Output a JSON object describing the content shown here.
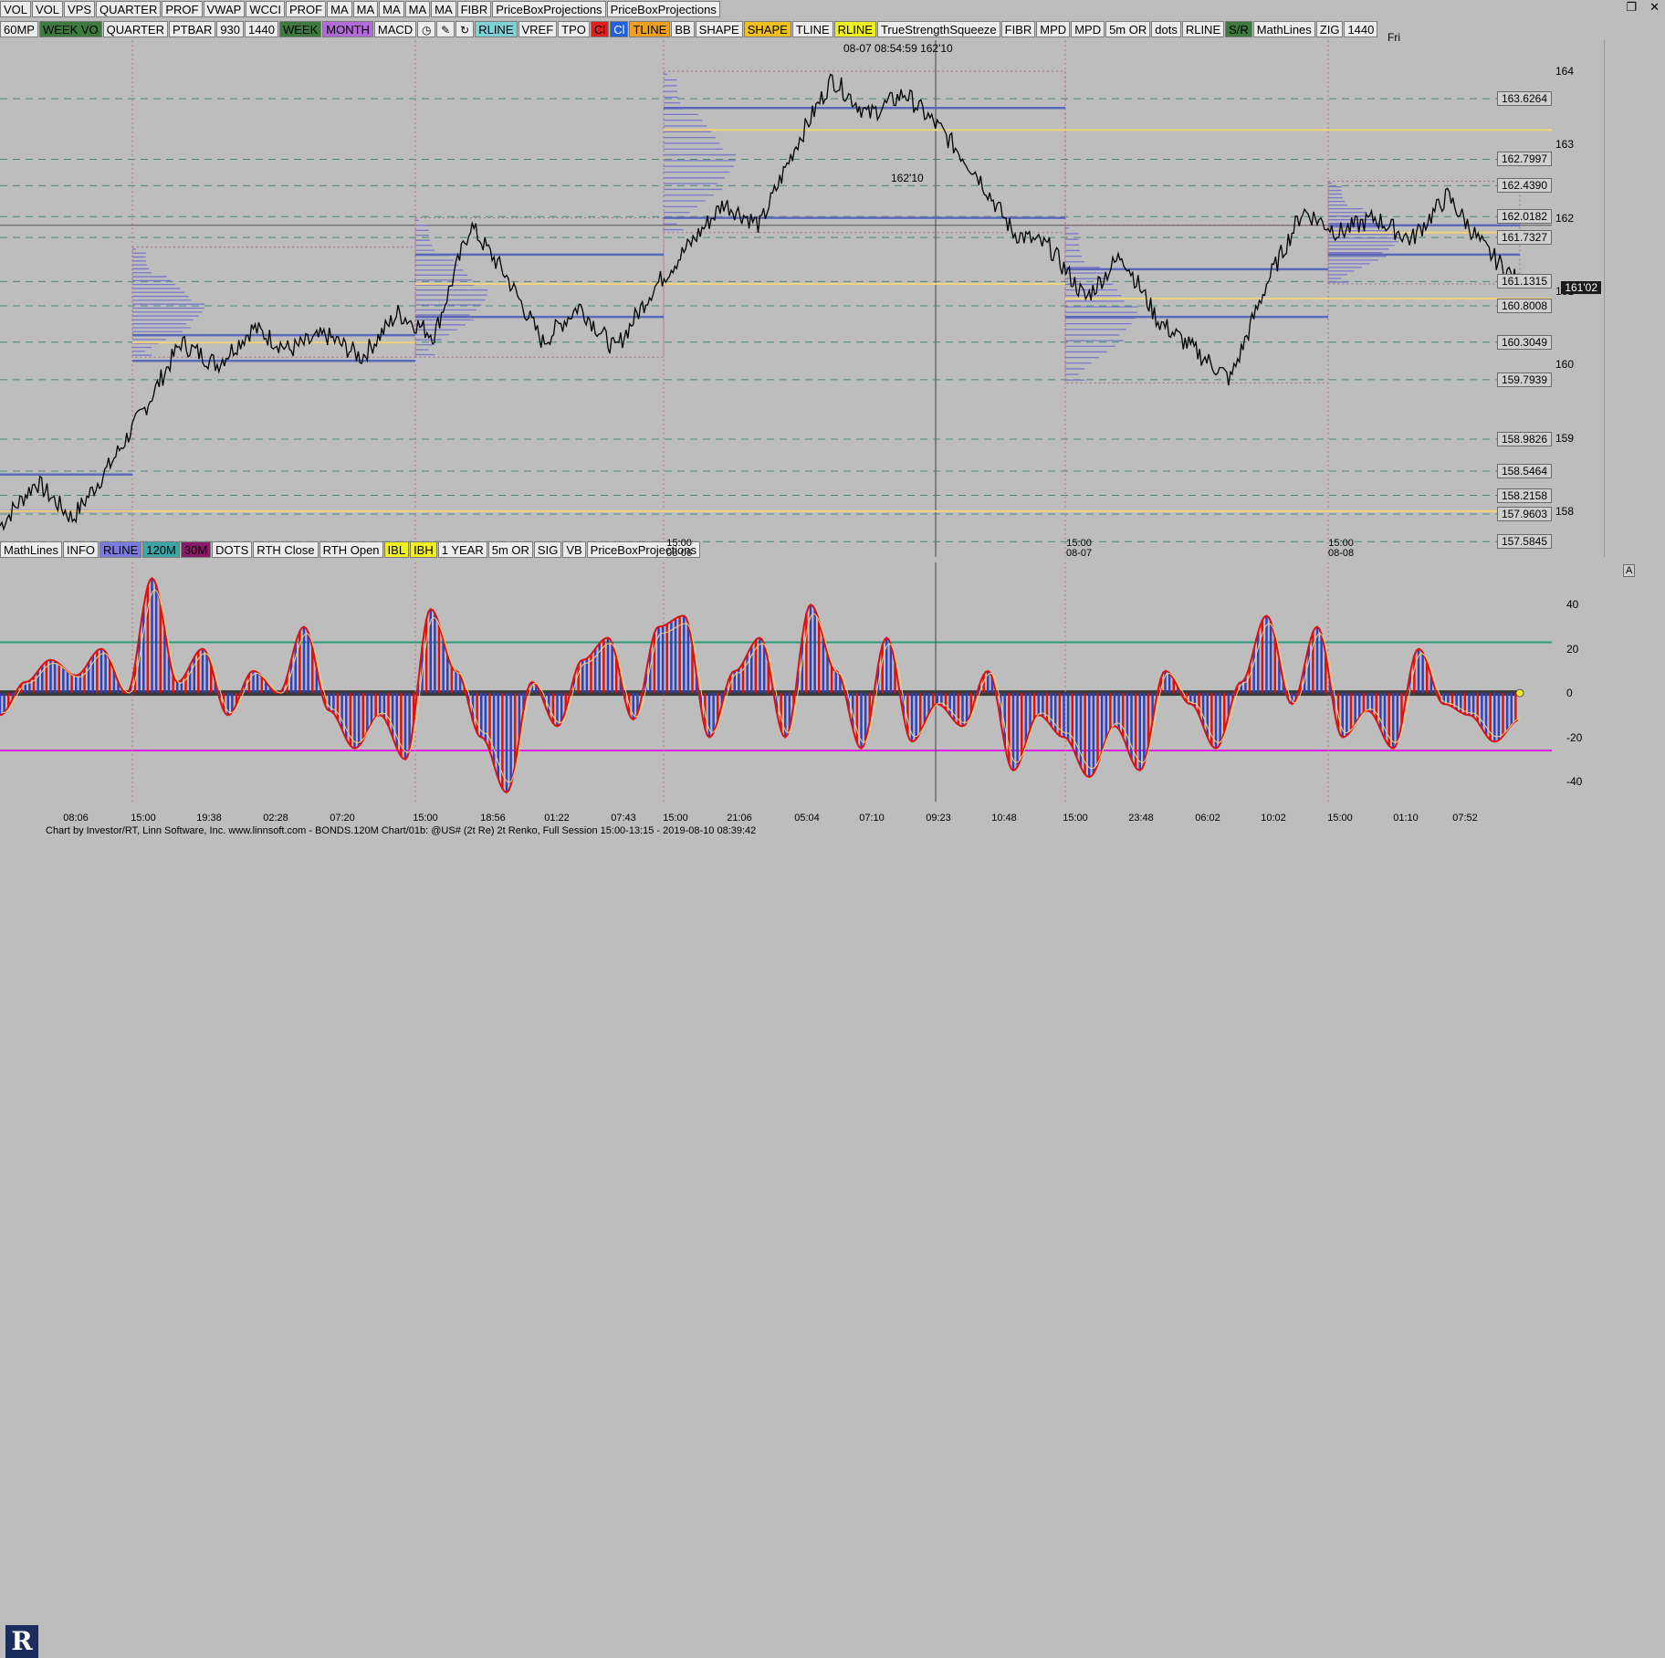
{
  "toolbar_top_1": [
    "VOL",
    "VOL",
    "VPS",
    "QUARTER",
    "PROF",
    "VWAP",
    "WCCI",
    "PROF",
    "MA",
    "MA",
    "MA",
    "MA",
    "MA",
    "FIBR",
    "PriceBoxProjections",
    "PriceBoxProjections"
  ],
  "toolbar_top_2": [
    {
      "label": "60MP"
    },
    {
      "label": "WEEK VO",
      "bg": "#3d7a3d",
      "fg": "#000"
    },
    {
      "label": "QUARTER"
    },
    {
      "label": "PTBAR"
    },
    {
      "label": "930"
    },
    {
      "label": "1440"
    },
    {
      "label": "WEEK",
      "bg": "#3d7a3d"
    },
    {
      "label": "MONTH",
      "bg": "#b06bd6"
    },
    {
      "label": "MACD"
    },
    {
      "icon": "clock-icon",
      "glyph": "◷"
    },
    {
      "icon": "pencil-icon",
      "glyph": "✎"
    },
    {
      "icon": "refresh-icon",
      "glyph": "↻"
    },
    {
      "label": "RLINE",
      "bg": "#7fd1d8"
    },
    {
      "label": "VREF"
    },
    {
      "label": "TPO"
    },
    {
      "label": "Cl",
      "bg": "#e02020"
    },
    {
      "label": "Cl",
      "bg": "#2060e0",
      "fg": "#fff"
    },
    {
      "label": "TLINE",
      "bg": "#f0a020"
    },
    {
      "label": "BB"
    },
    {
      "label": "SHAPE"
    },
    {
      "label": "SHAPE",
      "bg": "#f0c020"
    },
    {
      "label": "TLINE"
    },
    {
      "label": "RLINE",
      "bg": "#f0f020"
    },
    {
      "label": "TrueStrengthSqueeze"
    },
    {
      "label": "FIBR"
    },
    {
      "label": "MPD"
    },
    {
      "label": "MPD"
    },
    {
      "label": "5m OR"
    },
    {
      "label": "dots"
    },
    {
      "label": "RLINE"
    },
    {
      "label": "S/R",
      "bg": "#3d7a3d"
    },
    {
      "label": "MathLines"
    },
    {
      "label": "ZIG"
    },
    {
      "label": "1440"
    }
  ],
  "toolbar_lower": [
    {
      "label": "MathLines"
    },
    {
      "label": "INFO"
    },
    {
      "label": "RLINE",
      "bg": "#7a7ae0"
    },
    {
      "label": "120M",
      "bg": "#3aa6a6"
    },
    {
      "label": "30M",
      "bg": "#8a1a6a"
    },
    {
      "label": "DOTS"
    },
    {
      "label": "RTH Close"
    },
    {
      "label": "RTH Open"
    },
    {
      "label": "IBL",
      "bg": "#f0f020"
    },
    {
      "label": "IBH",
      "bg": "#f0f020"
    },
    {
      "label": "1 YEAR"
    },
    {
      "label": "5m OR"
    },
    {
      "label": "SIG"
    },
    {
      "label": "VB"
    },
    {
      "label": "PriceBoxProjections"
    }
  ],
  "annotations": {
    "crosshair_label": "08-07 08:54:59  162'10",
    "crosshair_price": "162'10",
    "day_label": "Fri",
    "current_price": "161'02",
    "pane_marker": "A"
  },
  "session_labels": [
    {
      "time": "15:00",
      "date": "08-06"
    },
    {
      "time": "15:00",
      "date": "08-07"
    },
    {
      "time": "15:00",
      "date": "08-08"
    }
  ],
  "price_axis_ticks": [
    "164",
    "163",
    "162",
    "161",
    "160",
    "159",
    "158"
  ],
  "price_levels": [
    "163.6264",
    "162.7997",
    "162.4390",
    "162.0182",
    "161.7327",
    "161.1315",
    "160.8008",
    "160.3049",
    "159.7939",
    "158.9826",
    "158.5464",
    "158.2158",
    "157.9603",
    "157.5845"
  ],
  "osc_axis_ticks": [
    "40",
    "20",
    "0",
    "-20",
    "-40"
  ],
  "time_axis": [
    "08:06",
    "15:00",
    "19:38",
    "02:28",
    "07:20",
    "15:00",
    "18:56",
    "01:22",
    "07:43",
    "15:00",
    "21:06",
    "05:04",
    "07:10",
    "09:23",
    "10:48",
    "15:00",
    "23:48",
    "06:02",
    "10:02",
    "15:00",
    "01:10",
    "07:52"
  ],
  "footer": "Chart by Investor/RT, Linn Software, Inc. www.linnsoft.com - BONDS.120M Chart/01b: @US# (2t Re) 2t Renko, Full Session 15:00-13:15 - 2019-08-10 08:39:42",
  "colors": {
    "background": "#bdbdbd",
    "price_line": "#000000",
    "level_blue": "#5a6ab8",
    "level_yellow": "#f2d27a",
    "dashed_level": "#4a8a7a",
    "osc_pos": "#3040c0",
    "osc_neg": "#e01010",
    "osc_upper": "#2a9a7a",
    "osc_lower": "#e020e0"
  },
  "chart_data": {
    "type": "line",
    "title": "",
    "xlabel": "",
    "ylabel": "",
    "ylim": [
      157.5,
      164.3
    ],
    "series": [
      {
        "name": "",
        "values": [
          157.8,
          158.4,
          157.9,
          158.6,
          159.4,
          160.3,
          160.0,
          160.5,
          160.2,
          160.4,
          160.1,
          160.7,
          160.4,
          161.9,
          161.2,
          160.3,
          160.8,
          160.2,
          161.0,
          161.6,
          162.2,
          161.9,
          163.0,
          163.9,
          163.4,
          163.7,
          163.2,
          162.6,
          161.8,
          161.6,
          160.9,
          161.5,
          160.6,
          160.2,
          159.8,
          161.1,
          162.1,
          161.8,
          162.0,
          161.7,
          162.3,
          161.6,
          161.1
        ]
      }
    ],
    "oscillator": {
      "name": "",
      "ylim": [
        -45,
        55
      ],
      "upper_band": 23,
      "lower_band": -26,
      "values": [
        -10,
        5,
        15,
        8,
        20,
        0,
        52,
        5,
        20,
        -10,
        10,
        0,
        30,
        -8,
        -25,
        -10,
        -30,
        38,
        10,
        -20,
        -45,
        5,
        -15,
        15,
        25,
        -12,
        30,
        35,
        -20,
        10,
        25,
        -20,
        40,
        10,
        -25,
        25,
        -22,
        -5,
        -15,
        10,
        -35,
        -10,
        -20,
        -38,
        -15,
        -35,
        10,
        -5,
        -25,
        5,
        35,
        -5,
        30,
        -20,
        -8,
        -25,
        20,
        -5,
        -10,
        -22,
        -12
      ]
    }
  }
}
